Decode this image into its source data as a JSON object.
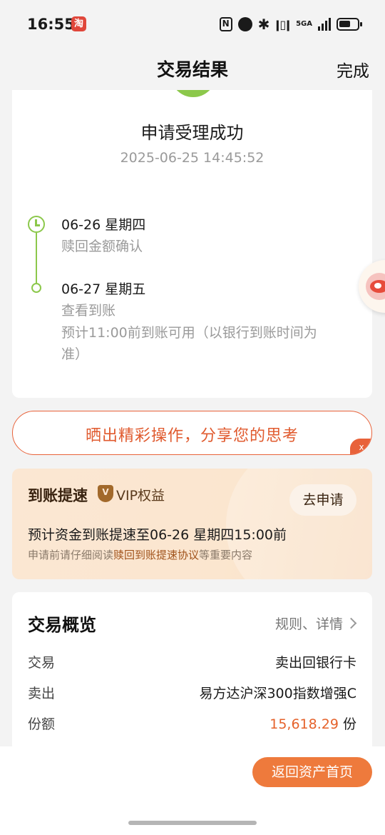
{
  "status_bar": {
    "time": "16:55",
    "app_badge": "淘",
    "network": "5GA"
  },
  "nav": {
    "title": "交易结果",
    "done_label": "完成"
  },
  "result": {
    "title": "申请受理成功",
    "timestamp": "2025-06-25 14:45:52",
    "timeline": [
      {
        "date": "06-26 星期四",
        "label": "赎回金额确认"
      },
      {
        "date": "06-27 星期五",
        "label": "查看到账",
        "note": "预计11:00前到账可用（以银行到账时间为准）"
      }
    ]
  },
  "share_banner": {
    "text": "晒出精彩操作，分享您的思考",
    "close": "x"
  },
  "vip": {
    "title": "到账提速",
    "tag": "VIP权益",
    "apply_label": "去申请",
    "estimate": "预计资金到账提速至06-26 星期四15:00前",
    "note_prefix": "申请前请仔细阅读",
    "note_link": "赎回到账提速协议",
    "note_suffix": "等重要内容"
  },
  "overview": {
    "title": "交易概览",
    "link": "规则、详情",
    "rows": [
      {
        "key": "交易",
        "value": "卖出回银行卡"
      },
      {
        "key": "卖出",
        "value": "易方达沪深300指数增强C"
      },
      {
        "key": "份额",
        "value": "15,618.29",
        "unit": "份"
      }
    ]
  },
  "bottom": {
    "home_label": "返回资产首页"
  },
  "colors": {
    "accent_green": "#8cc84b",
    "accent_orange": "#e8623a",
    "amount_orange": "#e5622b",
    "button_orange": "#ee7a3c"
  }
}
